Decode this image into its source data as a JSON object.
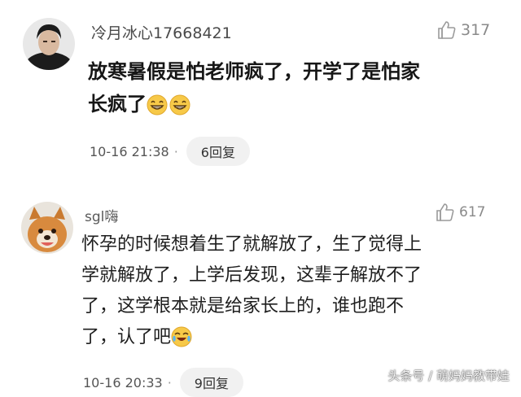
{
  "comments": [
    {
      "username": "冷月冰心17668421",
      "likes": "317",
      "text_line1": "放寒暑假是怕老师疯了，开学了是怕家",
      "text_line2": "长疯了",
      "emojis": [
        "grin-laugh-icon",
        "grin-laugh-icon"
      ],
      "timestamp": "10-16 21:38",
      "separator": "·",
      "replies": "6回复"
    },
    {
      "username": "sgl嗨",
      "likes": "617",
      "text_line1": "怀孕的时候想着生了就解放了，生了觉得上",
      "text_line2": "学就解放了，上学后发现，这辈子解放不了",
      "text_line3": "了，这学根本就是给家长上的，谁也跑不",
      "text_line4": "了，认了吧",
      "emojis": [
        "tears-of-joy-icon"
      ],
      "timestamp": "10-16 20:33",
      "separator": "·",
      "replies": "9回复"
    }
  ],
  "watermark": "头条号 / 萌妈妈教带娃",
  "colors": {
    "background": "#ffffff",
    "username": "#4a4a4a",
    "meta": "#555555",
    "reply_pill": "#f1f1f1",
    "emoji_yellow": "#f7c948"
  }
}
